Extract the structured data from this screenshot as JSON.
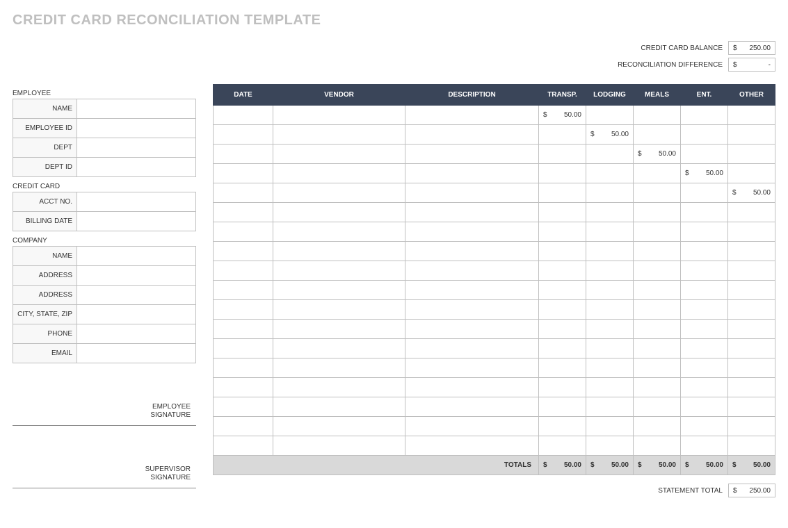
{
  "title": "CREDIT CARD RECONCILIATION TEMPLATE",
  "summary": {
    "credit_card_balance_label": "CREDIT CARD BALANCE",
    "credit_card_balance_value": "250.00",
    "reconciliation_diff_label": "RECONCILIATION DIFFERENCE",
    "reconciliation_diff_value": "-",
    "statement_total_label": "STATEMENT TOTAL",
    "statement_total_value": "250.00",
    "currency_symbol": "$"
  },
  "sections": {
    "employee": {
      "heading": "EMPLOYEE",
      "fields": {
        "name_label": "NAME",
        "name_value": "",
        "employee_id_label": "EMPLOYEE ID",
        "employee_id_value": "",
        "dept_label": "DEPT",
        "dept_value": "",
        "dept_id_label": "DEPT ID",
        "dept_id_value": ""
      }
    },
    "credit_card": {
      "heading": "CREDIT CARD",
      "fields": {
        "acct_no_label": "ACCT NO.",
        "acct_no_value": "",
        "billing_date_label": "BILLING DATE",
        "billing_date_value": ""
      }
    },
    "company": {
      "heading": "COMPANY",
      "fields": {
        "name_label": "NAME",
        "name_value": "",
        "address1_label": "ADDRESS",
        "address1_value": "",
        "address2_label": "ADDRESS",
        "address2_value": "",
        "city_state_zip_label": "CITY, STATE, ZIP",
        "city_state_zip_value": "",
        "phone_label": "PHONE",
        "phone_value": "",
        "email_label": "EMAIL",
        "email_value": ""
      }
    }
  },
  "signatures": {
    "employee_label": "EMPLOYEE SIGNATURE",
    "supervisor_label": "SUPERVISOR SIGNATURE"
  },
  "table": {
    "headers": {
      "date": "DATE",
      "vendor": "VENDOR",
      "description": "DESCRIPTION",
      "transp": "TRANSP.",
      "lodging": "LODGING",
      "meals": "MEALS",
      "ent": "ENT.",
      "other": "OTHER"
    },
    "rows": [
      {
        "date": "",
        "vendor": "",
        "description": "",
        "transp": "50.00",
        "lodging": "",
        "meals": "",
        "ent": "",
        "other": ""
      },
      {
        "date": "",
        "vendor": "",
        "description": "",
        "transp": "",
        "lodging": "50.00",
        "meals": "",
        "ent": "",
        "other": ""
      },
      {
        "date": "",
        "vendor": "",
        "description": "",
        "transp": "",
        "lodging": "",
        "meals": "50.00",
        "ent": "",
        "other": ""
      },
      {
        "date": "",
        "vendor": "",
        "description": "",
        "transp": "",
        "lodging": "",
        "meals": "",
        "ent": "50.00",
        "other": ""
      },
      {
        "date": "",
        "vendor": "",
        "description": "",
        "transp": "",
        "lodging": "",
        "meals": "",
        "ent": "",
        "other": "50.00"
      },
      {
        "date": "",
        "vendor": "",
        "description": "",
        "transp": "",
        "lodging": "",
        "meals": "",
        "ent": "",
        "other": ""
      },
      {
        "date": "",
        "vendor": "",
        "description": "",
        "transp": "",
        "lodging": "",
        "meals": "",
        "ent": "",
        "other": ""
      },
      {
        "date": "",
        "vendor": "",
        "description": "",
        "transp": "",
        "lodging": "",
        "meals": "",
        "ent": "",
        "other": ""
      },
      {
        "date": "",
        "vendor": "",
        "description": "",
        "transp": "",
        "lodging": "",
        "meals": "",
        "ent": "",
        "other": ""
      },
      {
        "date": "",
        "vendor": "",
        "description": "",
        "transp": "",
        "lodging": "",
        "meals": "",
        "ent": "",
        "other": ""
      },
      {
        "date": "",
        "vendor": "",
        "description": "",
        "transp": "",
        "lodging": "",
        "meals": "",
        "ent": "",
        "other": ""
      },
      {
        "date": "",
        "vendor": "",
        "description": "",
        "transp": "",
        "lodging": "",
        "meals": "",
        "ent": "",
        "other": ""
      },
      {
        "date": "",
        "vendor": "",
        "description": "",
        "transp": "",
        "lodging": "",
        "meals": "",
        "ent": "",
        "other": ""
      },
      {
        "date": "",
        "vendor": "",
        "description": "",
        "transp": "",
        "lodging": "",
        "meals": "",
        "ent": "",
        "other": ""
      },
      {
        "date": "",
        "vendor": "",
        "description": "",
        "transp": "",
        "lodging": "",
        "meals": "",
        "ent": "",
        "other": ""
      },
      {
        "date": "",
        "vendor": "",
        "description": "",
        "transp": "",
        "lodging": "",
        "meals": "",
        "ent": "",
        "other": ""
      },
      {
        "date": "",
        "vendor": "",
        "description": "",
        "transp": "",
        "lodging": "",
        "meals": "",
        "ent": "",
        "other": ""
      },
      {
        "date": "",
        "vendor": "",
        "description": "",
        "transp": "",
        "lodging": "",
        "meals": "",
        "ent": "",
        "other": ""
      }
    ],
    "totals": {
      "label": "TOTALS",
      "transp": "50.00",
      "lodging": "50.00",
      "meals": "50.00",
      "ent": "50.00",
      "other": "50.00"
    }
  }
}
